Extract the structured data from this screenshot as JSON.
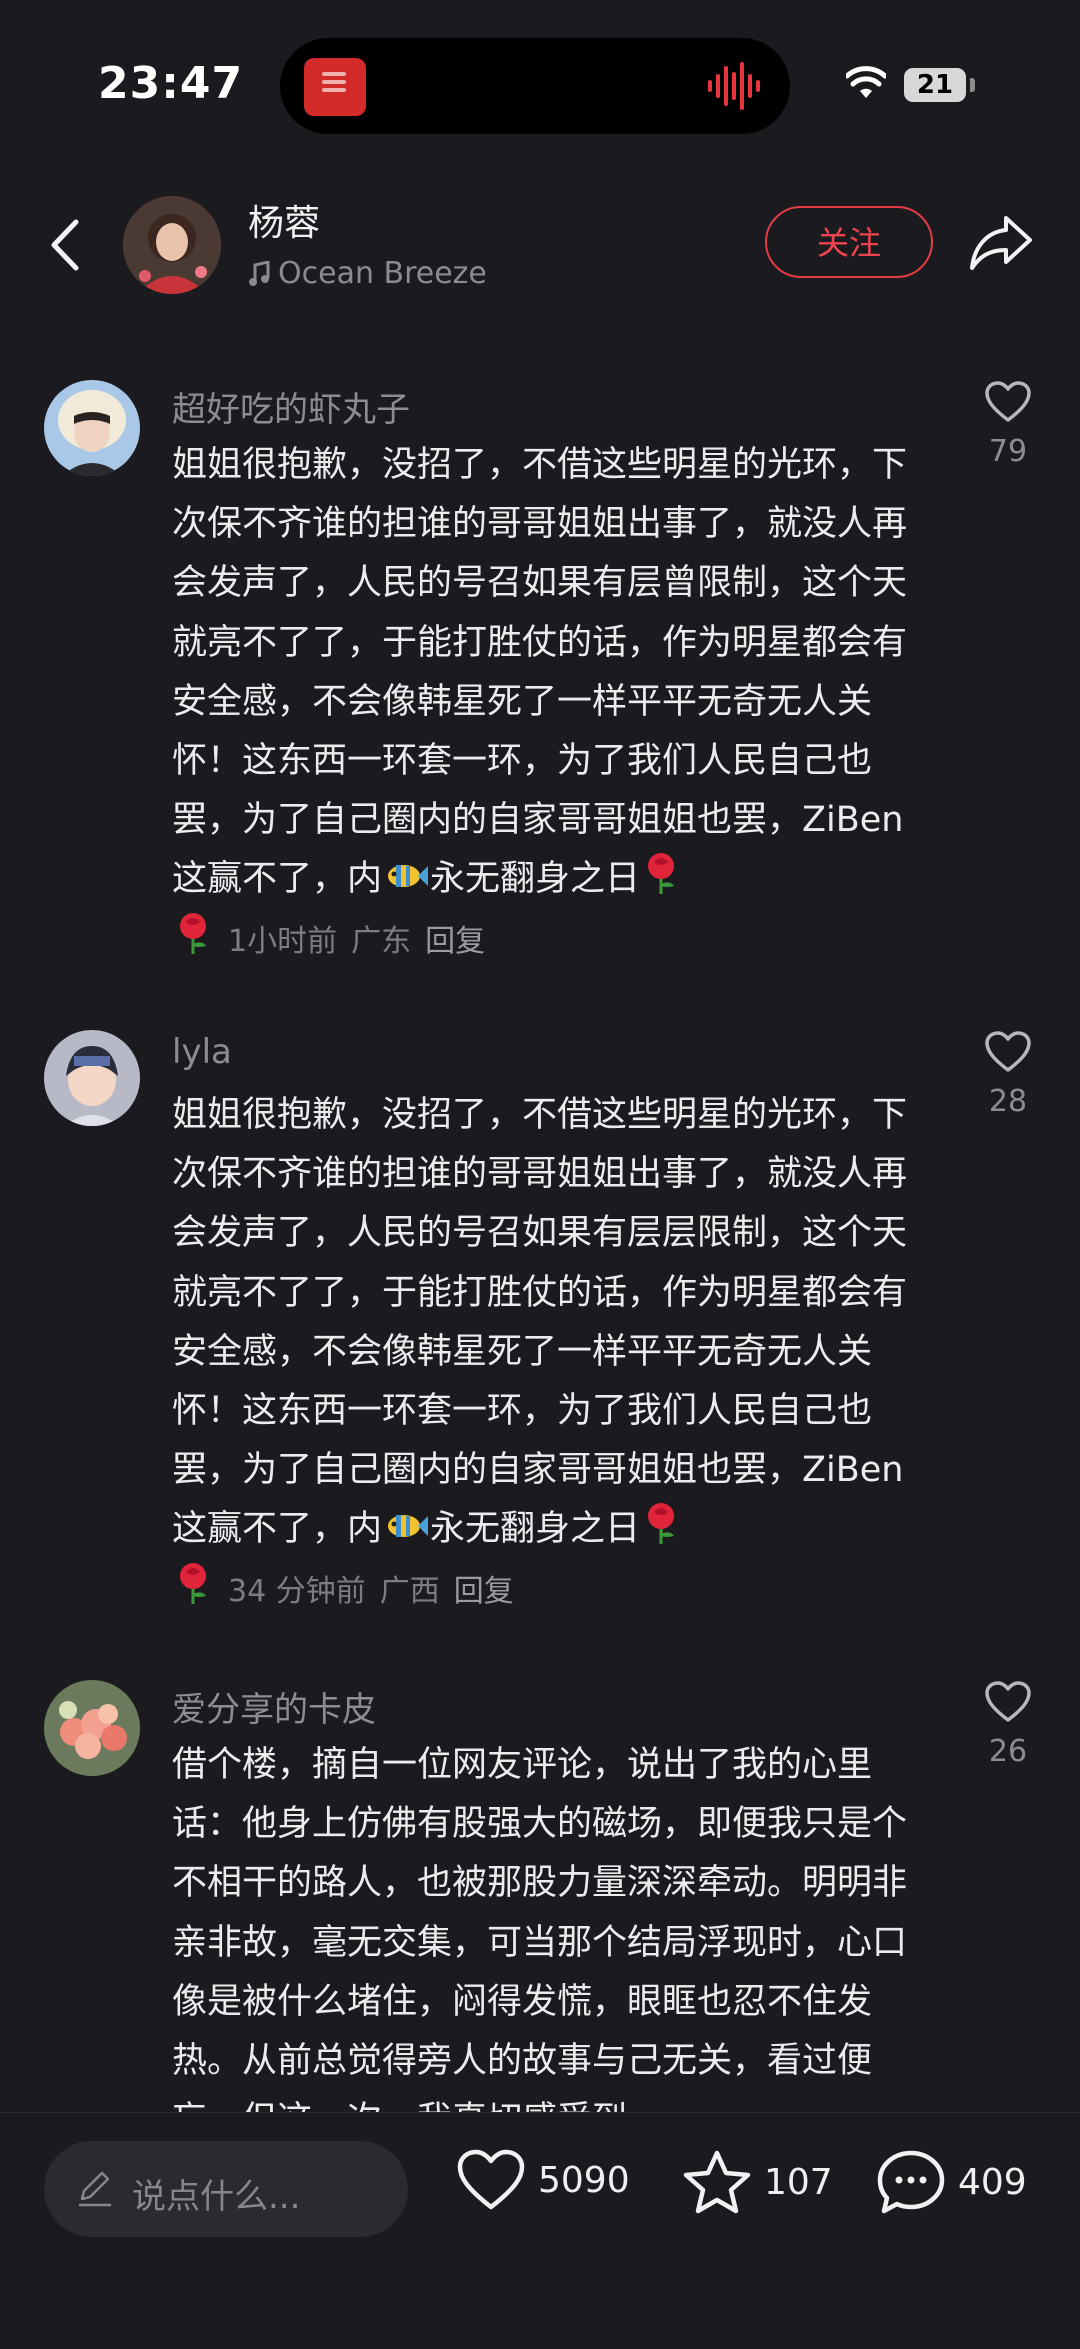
{
  "status": {
    "time": "23:47",
    "battery": "21"
  },
  "header": {
    "name": "杨蓉",
    "music": "Ocean Breeze",
    "follow_label": "关注"
  },
  "comments": [
    {
      "user": "超好吃的虾丸子",
      "text_before_fish": "姐姐很抱歉，没招了，不借这些明星的光环，下次保不齐谁的担谁的哥哥姐姐出事了，就没人再会发声了，人民的号召如果有层曾限制，这个天就亮不了了，于能打胜仗的话，作为明星都会有安全感，不会像韩星死了一样平平无奇无人关怀！这东西一环套一环，为了我们人民自己也罢，为了自己圈内的自家哥哥姐姐也罢，ZiBen这赢不了，内",
      "text_after_fish": "永无翻身之日",
      "time": "1小时前",
      "location": "广东",
      "reply": "回复",
      "likes": "79"
    },
    {
      "user": "lyla",
      "text_before_fish": "姐姐很抱歉，没招了，不借这些明星的光环，下次保不齐谁的担谁的哥哥姐姐出事了，就没人再会发声了，人民的号召如果有层层限制，这个天就亮不了了，于能打胜仗的话，作为明星都会有安全感，不会像韩星死了一样平平无奇无人关怀！这东西一环套一环，为了我们人民自己也罢，为了自己圈内的自家哥哥姐姐也罢，ZiBen这赢不了，内",
      "text_after_fish": "永无翻身之日",
      "time": "34 分钟前",
      "location": "广西",
      "reply": "回复",
      "likes": "28"
    },
    {
      "user": "爱分享的卡皮",
      "text": "借个楼，摘自一位网友评论，说出了我的心里话：他身上仿佛有股强大的磁场，即便我只是个不相干的路人，也被那股力量深深牵动。明明非亲非故，毫无交集，可当那个结局浮现时，心口像是被什么堵住，闷得发慌，眼眶也忍不住发热。从前总觉得旁人的故事与己无关，看过便忘，但这一次，我真切感受到",
      "likes": "26"
    }
  ],
  "bottom": {
    "input_placeholder": "说点什么...",
    "likes": "5090",
    "favorites": "107",
    "comments": "409"
  }
}
